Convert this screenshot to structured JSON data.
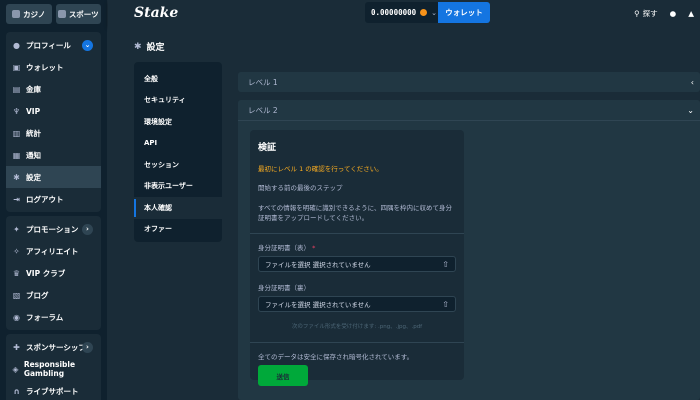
{
  "sidebar": {
    "top_buttons": [
      {
        "label": "カジノ"
      },
      {
        "label": "スポーツ"
      }
    ],
    "group1": [
      {
        "label": "プロフィール",
        "icon": "user-icon",
        "expanded": true
      },
      {
        "label": "ウォレット",
        "icon": "wallet-icon"
      },
      {
        "label": "金庫",
        "icon": "vault-icon"
      },
      {
        "label": "VIP",
        "icon": "trophy-icon"
      },
      {
        "label": "統計",
        "icon": "stats-icon"
      },
      {
        "label": "通知",
        "icon": "bell-icon"
      },
      {
        "label": "設定",
        "icon": "gear-icon",
        "active": true
      },
      {
        "label": "ログアウト",
        "icon": "logout-icon"
      }
    ],
    "group2": [
      {
        "label": "プロモーション",
        "icon": "gift-icon"
      },
      {
        "label": "アフィリエイト",
        "icon": "affiliate-icon"
      },
      {
        "label": "VIP クラブ",
        "icon": "crown-icon"
      },
      {
        "label": "ブログ",
        "icon": "blog-icon"
      },
      {
        "label": "フォーラム",
        "icon": "forum-icon"
      }
    ],
    "group3": [
      {
        "label": "スポンサーシップ",
        "icon": "sponsor-icon"
      },
      {
        "label": "Responsible Gambling",
        "icon": "shield-icon"
      },
      {
        "label": "ライブサポート",
        "icon": "headset-icon"
      }
    ]
  },
  "header": {
    "logo": "Stake",
    "balance": "0.00000000",
    "wallet_button": "ウォレット",
    "search_label": "探す"
  },
  "main": {
    "title": "設定",
    "nav": [
      {
        "label": "全般"
      },
      {
        "label": "セキュリティ"
      },
      {
        "label": "環境設定"
      },
      {
        "label": "API"
      },
      {
        "label": "セッション"
      },
      {
        "label": "非表示ユーザー"
      },
      {
        "label": "本人確認",
        "active": true
      },
      {
        "label": "オファー"
      }
    ],
    "level1": "レベル 1",
    "level2": "レベル 2",
    "verify": {
      "title": "検証",
      "warning": "最初にレベル 1 の確認を行ってください。",
      "step_text": "開始する前の最後のステップ",
      "instructions": "すべての情報を明確に識別できるように、四隅を枠内に収めて身分証明書をアップロードしてください。",
      "front_label": "身分証明書（表）",
      "front_required": "*",
      "front_value": "ファイルを選択 選択されていません",
      "back_label": "身分証明書（裏）",
      "back_value": "ファイルを選択 選択されていません",
      "hint": "次のファイル形式を受け付けます: .png、.jpg、.pdf",
      "secure_text": "全てのデータは安全に保存され暗号化されています。",
      "submit": "送信"
    }
  },
  "colors": {
    "accent": "#1475e1",
    "success": "#00a93a",
    "warning": "#ffb020"
  }
}
